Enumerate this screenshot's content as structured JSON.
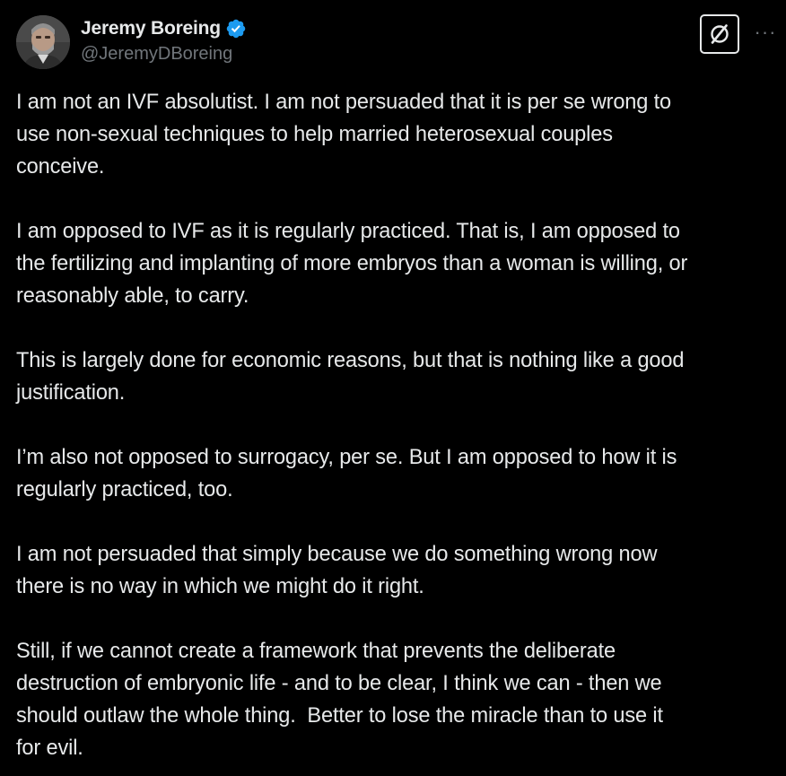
{
  "author": {
    "display_name": "Jeremy Boreing",
    "handle": "@JeremyDBoreing",
    "verified_color": "#1d9bf0"
  },
  "actions": {
    "grok_icon": "grok-icon",
    "more_label": "···"
  },
  "tweet": {
    "paragraphs": [
      "I am not an IVF absolutist. I am not persuaded that it is per se wrong to\nuse non-sexual techniques to help married heterosexual couples\nconceive.",
      "I am opposed to IVF as it is regularly practiced. That is, I am opposed to\nthe fertilizing and implanting of more embryos than a woman is willing, or\nreasonably able, to carry.",
      "This is largely done for economic reasons, but that is nothing like a good\njustification.",
      "I’m also not opposed to surrogacy, per se. But I am opposed to how it is\nregularly practiced, too.",
      "I am not persuaded that simply because we do something wrong now\nthere is no way in which we might do it right.",
      "Still, if we cannot create a framework that prevents the deliberate\ndestruction of embryonic life - and to be clear, I think we can - then we\nshould outlaw the whole thing.  Better to lose the miracle than to use it\nfor evil."
    ]
  }
}
